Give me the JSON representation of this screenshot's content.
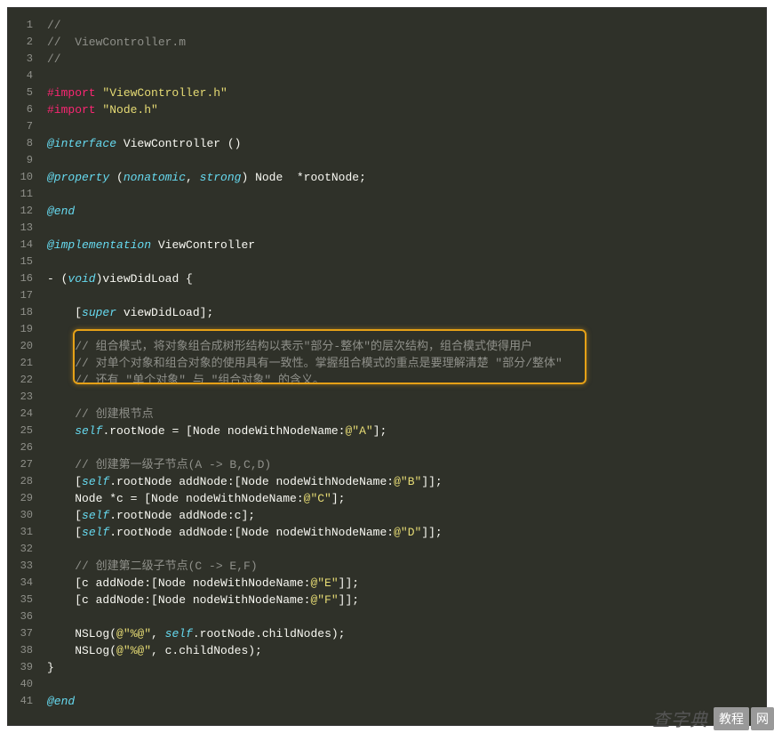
{
  "code": {
    "lines": [
      {
        "n": 1,
        "tokens": [
          {
            "t": "//",
            "c": "tok-comment"
          }
        ]
      },
      {
        "n": 2,
        "tokens": [
          {
            "t": "//  ViewController.m",
            "c": "tok-comment"
          }
        ]
      },
      {
        "n": 3,
        "tokens": [
          {
            "t": "//",
            "c": "tok-comment"
          }
        ]
      },
      {
        "n": 4,
        "tokens": []
      },
      {
        "n": 5,
        "tokens": [
          {
            "t": "#import ",
            "c": "tok-objc"
          },
          {
            "t": "\"ViewController.h\"",
            "c": "tok-string"
          }
        ]
      },
      {
        "n": 6,
        "tokens": [
          {
            "t": "#import ",
            "c": "tok-objc"
          },
          {
            "t": "\"Node.h\"",
            "c": "tok-string"
          }
        ]
      },
      {
        "n": 7,
        "tokens": []
      },
      {
        "n": 8,
        "tokens": [
          {
            "t": "@interface",
            "c": "tok-keyword-blue"
          },
          {
            "t": " ",
            "c": "tok-white"
          },
          {
            "t": "ViewController",
            "c": "tok-white"
          },
          {
            "t": " ()",
            "c": "tok-white"
          }
        ]
      },
      {
        "n": 9,
        "tokens": []
      },
      {
        "n": 10,
        "tokens": [
          {
            "t": "@property",
            "c": "tok-keyword-blue"
          },
          {
            "t": " (",
            "c": "tok-white"
          },
          {
            "t": "nonatomic",
            "c": "tok-keyword-blue"
          },
          {
            "t": ", ",
            "c": "tok-white"
          },
          {
            "t": "strong",
            "c": "tok-keyword-blue"
          },
          {
            "t": ") Node  *rootNode;",
            "c": "tok-white"
          }
        ]
      },
      {
        "n": 11,
        "tokens": []
      },
      {
        "n": 12,
        "tokens": [
          {
            "t": "@end",
            "c": "tok-keyword-blue"
          }
        ]
      },
      {
        "n": 13,
        "tokens": []
      },
      {
        "n": 14,
        "tokens": [
          {
            "t": "@implementation",
            "c": "tok-keyword-blue"
          },
          {
            "t": " ",
            "c": "tok-white"
          },
          {
            "t": "ViewController",
            "c": "tok-white"
          }
        ]
      },
      {
        "n": 15,
        "tokens": []
      },
      {
        "n": 16,
        "tokens": [
          {
            "t": "- (",
            "c": "tok-white"
          },
          {
            "t": "void",
            "c": "tok-keyword-blue"
          },
          {
            "t": ")viewDidLoad {",
            "c": "tok-white"
          }
        ]
      },
      {
        "n": 17,
        "tokens": []
      },
      {
        "n": 18,
        "tokens": [
          {
            "t": "    [",
            "c": "tok-white"
          },
          {
            "t": "super",
            "c": "tok-keyword-blue"
          },
          {
            "t": " viewDidLoad];",
            "c": "tok-white"
          }
        ]
      },
      {
        "n": 19,
        "tokens": []
      },
      {
        "n": 20,
        "tokens": [
          {
            "t": "    // 组合模式，将对象组合成树形结构以表示\"部分-整体\"的层次结构，组合模式使得用户",
            "c": "tok-comment"
          }
        ]
      },
      {
        "n": 21,
        "tokens": [
          {
            "t": "    // 对单个对象和组合对象的使用具有一致性。掌握组合模式的重点是要理解清楚 \"部分/整体\"",
            "c": "tok-comment"
          }
        ]
      },
      {
        "n": 22,
        "tokens": [
          {
            "t": "    // 还有 \"单个对象\" 与 \"组合对象\" 的含义。",
            "c": "tok-comment"
          }
        ]
      },
      {
        "n": 23,
        "tokens": []
      },
      {
        "n": 24,
        "tokens": [
          {
            "t": "    // 创建根节点",
            "c": "tok-comment"
          }
        ]
      },
      {
        "n": 25,
        "tokens": [
          {
            "t": "    ",
            "c": "tok-white"
          },
          {
            "t": "self",
            "c": "tok-self"
          },
          {
            "t": ".rootNode = [Node nodeWithNodeName:",
            "c": "tok-white"
          },
          {
            "t": "@\"A\"",
            "c": "tok-string"
          },
          {
            "t": "];",
            "c": "tok-white"
          }
        ]
      },
      {
        "n": 26,
        "tokens": []
      },
      {
        "n": 27,
        "tokens": [
          {
            "t": "    // 创建第一级子节点(A -> B,C,D)",
            "c": "tok-comment"
          }
        ]
      },
      {
        "n": 28,
        "tokens": [
          {
            "t": "    [",
            "c": "tok-white"
          },
          {
            "t": "self",
            "c": "tok-self"
          },
          {
            "t": ".rootNode addNode:[Node nodeWithNodeName:",
            "c": "tok-white"
          },
          {
            "t": "@\"B\"",
            "c": "tok-string"
          },
          {
            "t": "]];",
            "c": "tok-white"
          }
        ]
      },
      {
        "n": 29,
        "tokens": [
          {
            "t": "    Node *c = [Node nodeWithNodeName:",
            "c": "tok-white"
          },
          {
            "t": "@\"C\"",
            "c": "tok-string"
          },
          {
            "t": "];",
            "c": "tok-white"
          }
        ]
      },
      {
        "n": 30,
        "tokens": [
          {
            "t": "    [",
            "c": "tok-white"
          },
          {
            "t": "self",
            "c": "tok-self"
          },
          {
            "t": ".rootNode addNode:c];",
            "c": "tok-white"
          }
        ]
      },
      {
        "n": 31,
        "tokens": [
          {
            "t": "    [",
            "c": "tok-white"
          },
          {
            "t": "self",
            "c": "tok-self"
          },
          {
            "t": ".rootNode addNode:[Node nodeWithNodeName:",
            "c": "tok-white"
          },
          {
            "t": "@\"D\"",
            "c": "tok-string"
          },
          {
            "t": "]];",
            "c": "tok-white"
          }
        ]
      },
      {
        "n": 32,
        "tokens": []
      },
      {
        "n": 33,
        "tokens": [
          {
            "t": "    // 创建第二级子节点(C -> E,F)",
            "c": "tok-comment"
          }
        ]
      },
      {
        "n": 34,
        "tokens": [
          {
            "t": "    [c addNode:[Node nodeWithNodeName:",
            "c": "tok-white"
          },
          {
            "t": "@\"E\"",
            "c": "tok-string"
          },
          {
            "t": "]];",
            "c": "tok-white"
          }
        ]
      },
      {
        "n": 35,
        "tokens": [
          {
            "t": "    [c addNode:[Node nodeWithNodeName:",
            "c": "tok-white"
          },
          {
            "t": "@\"F\"",
            "c": "tok-string"
          },
          {
            "t": "]];",
            "c": "tok-white"
          }
        ]
      },
      {
        "n": 36,
        "tokens": []
      },
      {
        "n": 37,
        "tokens": [
          {
            "t": "    NSLog(",
            "c": "tok-white"
          },
          {
            "t": "@\"%@\"",
            "c": "tok-string"
          },
          {
            "t": ", ",
            "c": "tok-white"
          },
          {
            "t": "self",
            "c": "tok-self"
          },
          {
            "t": ".rootNode.childNodes);",
            "c": "tok-white"
          }
        ]
      },
      {
        "n": 38,
        "tokens": [
          {
            "t": "    NSLog(",
            "c": "tok-white"
          },
          {
            "t": "@\"%@\"",
            "c": "tok-string"
          },
          {
            "t": ", c.childNodes);",
            "c": "tok-white"
          }
        ]
      },
      {
        "n": 39,
        "tokens": [
          {
            "t": "}",
            "c": "tok-white"
          }
        ]
      },
      {
        "n": 40,
        "tokens": []
      },
      {
        "n": 41,
        "tokens": [
          {
            "t": "@end",
            "c": "tok-keyword-blue"
          }
        ]
      }
    ]
  },
  "watermark": {
    "text": "查字典",
    "badge1": "教程",
    "badge2": "网",
    "url": "jiaocheng.chazidian.com"
  }
}
